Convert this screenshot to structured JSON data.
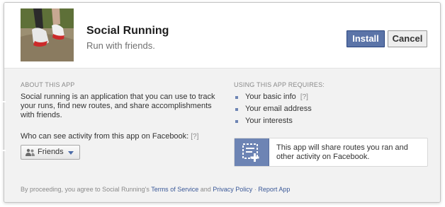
{
  "header": {
    "app_name": "Social Running",
    "tagline": "Run with friends.",
    "install_label": "Install",
    "cancel_label": "Cancel"
  },
  "about": {
    "heading": "ABOUT THIS APP",
    "description": "Social running is an application that you can use to track your runs, find new routes, and share accomplishments with friends.",
    "audience_question": "Who can see activity from this app on Facebook:",
    "audience_help": "[?]",
    "audience_value": "Friends"
  },
  "requirements": {
    "heading": "USING THIS APP REQUIRES:",
    "items": [
      {
        "label": "Your basic info",
        "help": "[?]"
      },
      {
        "label": "Your email address"
      },
      {
        "label": "Your interests"
      }
    ],
    "share_notice": "This app will share routes you ran and other activity on Facebook."
  },
  "footer": {
    "prefix": "By proceeding, you agree to Social Running's",
    "terms": "Terms of Service",
    "and": "and",
    "privacy": "Privacy Policy",
    "separator": "·",
    "report": "Report App"
  },
  "colors": {
    "install_button": "#5b74a8",
    "accent_blue": "#6d84b4",
    "link": "#3b5998",
    "panel_background": "#f2f2f2"
  },
  "icons": {
    "audience": "people-icon",
    "audience_dropdown": "chevron-down-icon",
    "share": "share-activity-icon"
  }
}
